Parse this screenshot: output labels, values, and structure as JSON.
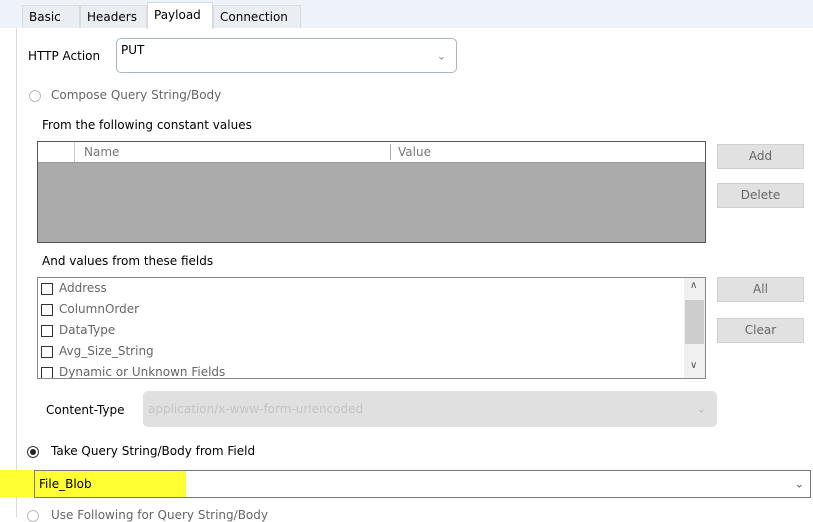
{
  "tabs": [
    "Basic",
    "Headers",
    "Payload",
    "Connection"
  ],
  "http_action": {
    "label": "HTTP Action",
    "value": "PUT"
  },
  "compose": {
    "label": "Compose Query String/Body",
    "selected": false
  },
  "constants": {
    "label": "From the following constant values",
    "columns": [
      "Name",
      "Value"
    ],
    "add": "Add",
    "delete": "Delete"
  },
  "fields": {
    "label": "And values from these fields",
    "items": [
      "Address",
      "ColumnOrder",
      "DataType",
      "Avg_Size_String",
      "Dynamic or Unknown Fields"
    ],
    "all": "All",
    "clear": "Clear"
  },
  "content_type": {
    "label": "Content-Type",
    "value": "application/x-www-form-urlencoded"
  },
  "take_field": {
    "label": "Take Query String/Body from Field",
    "selected": true,
    "value": "File_Blob"
  },
  "use_following": {
    "label": "Use Following for Query String/Body",
    "selected": false
  },
  "colors": {
    "highlight": "#ffff33",
    "grid_body": "#ababab"
  }
}
